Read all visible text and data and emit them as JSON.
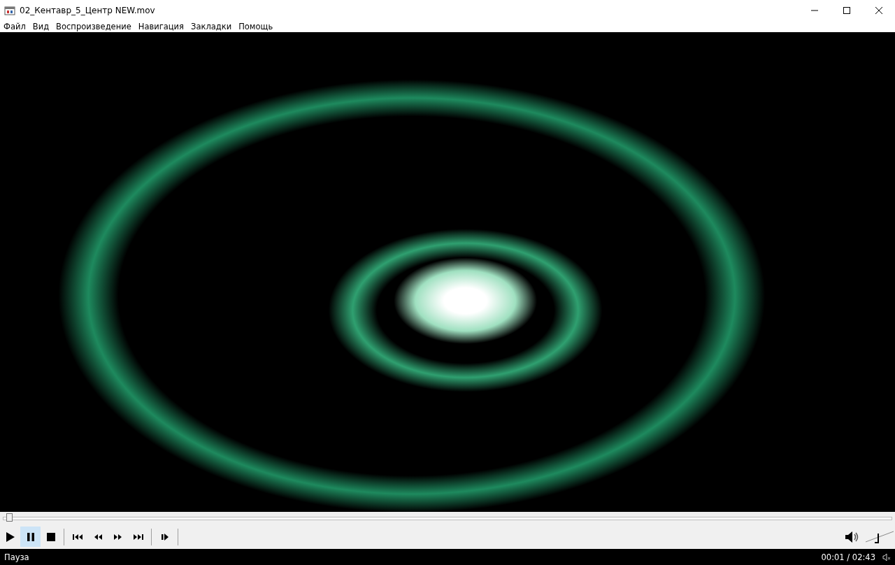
{
  "window": {
    "title": "02_Кентавр_5_Центр NEW.mov"
  },
  "menu": [
    "Файл",
    "Вид",
    "Воспроизведение",
    "Навигация",
    "Закладки",
    "Помощь"
  ],
  "seek": {
    "level": 0.006
  },
  "controls": [
    {
      "kind": "play",
      "selected": false
    },
    {
      "kind": "pause",
      "selected": true
    },
    {
      "kind": "stop",
      "selected": false
    },
    {
      "kind": "sep"
    },
    {
      "kind": "prev",
      "selected": false
    },
    {
      "kind": "rewind",
      "selected": false
    },
    {
      "kind": "forward",
      "selected": false
    },
    {
      "kind": "next",
      "selected": false
    },
    {
      "kind": "sep"
    },
    {
      "kind": "step",
      "selected": false
    },
    {
      "kind": "sep"
    }
  ],
  "volume": {
    "level": 0.4
  },
  "status": {
    "state": "Пауза",
    "time": "00:01 / 02:43"
  }
}
